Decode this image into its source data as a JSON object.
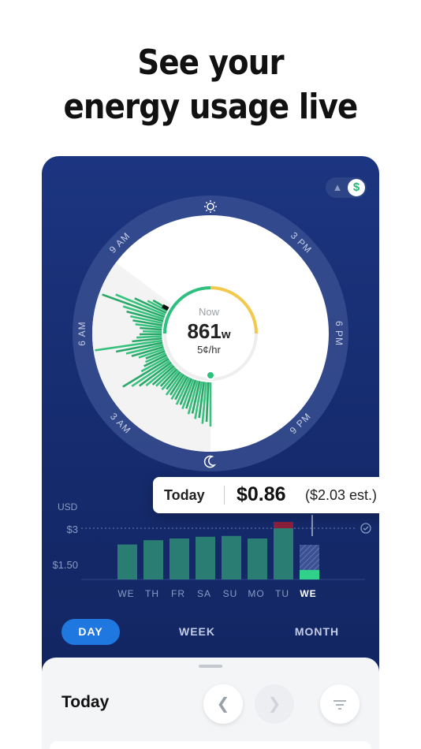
{
  "headline": {
    "line1": "See your",
    "line2": "energy usage live"
  },
  "toggle": {
    "left_icon": "chart-icon",
    "right_label": "$"
  },
  "dial": {
    "labels": [
      "9 AM",
      "3 PM",
      "6 AM",
      "6 PM",
      "3 AM",
      "9 PM"
    ],
    "now_label": "Now",
    "now_value": "861",
    "now_unit": "w",
    "now_rate": "5¢/hr",
    "top_icon": "sun-icon",
    "bottom_icon": "moon-icon"
  },
  "tooltip": {
    "label": "Today",
    "value": "$0.86",
    "estimate": "($2.03 est.)"
  },
  "chart_data": {
    "type": "bar",
    "ylabel": "USD",
    "y_ticks": [
      "$3",
      "$1.50"
    ],
    "categories": [
      "WE",
      "TH",
      "FR",
      "SA",
      "SU",
      "MO",
      "TU",
      "WE"
    ],
    "values": [
      2.05,
      2.3,
      2.4,
      2.5,
      2.55,
      2.4,
      3.3,
      0.86
    ],
    "projected_today": 2.03,
    "ylim": [
      0,
      3.5
    ],
    "active_category": 7
  },
  "tabs": {
    "day": "DAY",
    "week": "WEEK",
    "month": "MONTH"
  },
  "sheet": {
    "title": "Today"
  },
  "colors": {
    "card_bg": "#1c3580",
    "bar": "#2a7d73",
    "bar_today": "#2fd18b",
    "over_budget": "#8b1f3c",
    "accent": "#1f78e0"
  }
}
